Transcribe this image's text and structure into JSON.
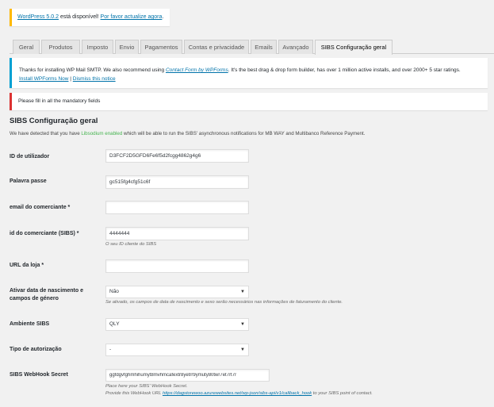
{
  "update_nag": {
    "link1": "WordPress 5.0.2",
    "text": " está disponível! ",
    "link2": "Por favor actualize agora",
    "end": "."
  },
  "tabs": [
    {
      "label": "Geral"
    },
    {
      "label": "Produtos"
    },
    {
      "label": "Imposto"
    },
    {
      "label": "Envio"
    },
    {
      "label": "Pagamentos"
    },
    {
      "label": "Contas e privacidade"
    },
    {
      "label": "Emails"
    },
    {
      "label": "Avançado"
    },
    {
      "label": "SIBS Configuração geral"
    }
  ],
  "notice_info": {
    "text1": "Thanks for installing WP Mail SMTP. We also recommend using ",
    "link": "Contact Form by WPForms",
    "text2": ". It's the best drag & drop form builder, has over 1 million active installs, and over 2000+ 5 star ratings.",
    "install_link": "Install WPForms Now",
    "separator": " | ",
    "dismiss_link": "Dismiss this notice"
  },
  "notice_error": {
    "text": "Please fill in all the mandatory fields"
  },
  "section": {
    "title": "SIBS Configuração geral",
    "desc1": "We have detected that you have ",
    "desc_green": "Libsodium enabled",
    "desc2": " which will be able to run the SIBS' asynchronous notifications for MB WAY and Multibanco Reference Payment."
  },
  "fields": {
    "id_utilizador": {
      "label": "ID de utilizador",
      "value": "D3FCF2D5GFD6Fe6f5d2fcgg4862g4g6"
    },
    "palavra_passe": {
      "label": "Palavra passe",
      "value": "gc515fg4cfg51c6f"
    },
    "email": {
      "label": "email do comerciante *",
      "value": ""
    },
    "id_comerciante": {
      "label": "id do comerciante (SIBS) *",
      "value": "4444444",
      "help": "O seu ID cliente do SIBS"
    },
    "url_loja": {
      "label": "URL da loja *",
      "value": ""
    },
    "ativar_data": {
      "label": "Ativar data de nascimento e campos de género",
      "value": "Não",
      "help": "Se ativado, os campos de data de nascimento e sexo serão necessários nas informações de faturamento do cliente."
    },
    "ambiente": {
      "label": "Ambiente SIBS",
      "value": "QLY"
    },
    "tipo_autorizacao": {
      "label": "Tipo de autorização",
      "value": "-"
    },
    "webhook_secret": {
      "label": "SIBS WebHook Secret",
      "value": "ggfdgvfghmhihumyt8mvhmcafextr8yetrr9ymuty80twr7et7rt7r",
      "help1": "Place here your SIBS' WebHook Secret.",
      "help2a": "Provide this WebHook URL ",
      "help2_link": "https://dagstorewoo.azurewebsites.net/wp-json/sibs-api/v1/callback_hook",
      "help2b": " to your SIBS point of contact."
    }
  },
  "icons": {
    "select_arrow": "chevron-down-icon"
  }
}
